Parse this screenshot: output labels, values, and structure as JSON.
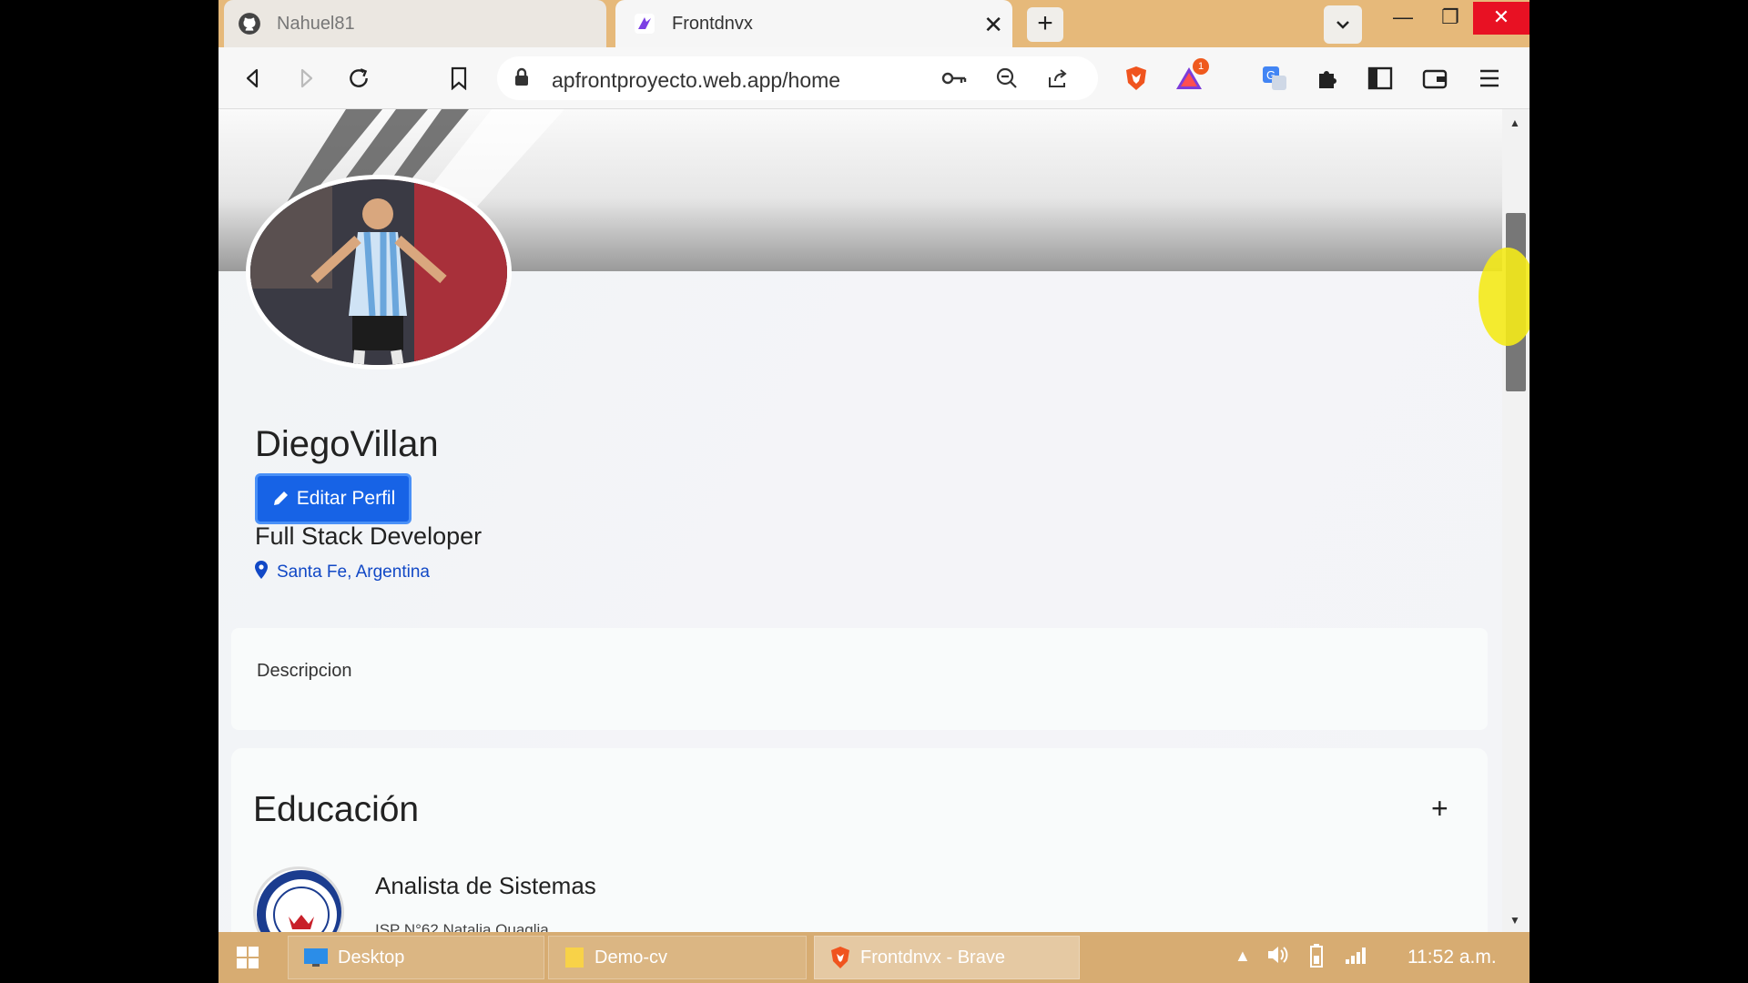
{
  "browser": {
    "tabs": [
      {
        "title": "Nahuel81",
        "icon": "github-icon"
      },
      {
        "title": "Frontdnvx",
        "icon": "app-favicon"
      }
    ],
    "new_tab_label": "+",
    "url": "apfrontproyecto.web.app/home",
    "notification_count": "1"
  },
  "profile": {
    "name": "DiegoVillan",
    "edit_label": "Editar Perfil",
    "title": "Full Stack Developer",
    "location": "Santa Fe, Argentina"
  },
  "description": {
    "text": "Descripcion"
  },
  "education": {
    "title": "Educación",
    "add_label": "+",
    "items": [
      {
        "degree": "Analista de Sistemas",
        "institution": "ISP N°62 Natalia Quaglia"
      }
    ]
  },
  "taskbar": {
    "items": [
      {
        "label": "Desktop"
      },
      {
        "label": "Demo-cv"
      },
      {
        "label": "Frontdnvx - Brave"
      }
    ],
    "clock": "11:52 a.m."
  },
  "colors": {
    "accent": "#1763e6",
    "link": "#1148c6",
    "tabbar": "#e6b97a",
    "taskbar": "#d7ac72"
  }
}
